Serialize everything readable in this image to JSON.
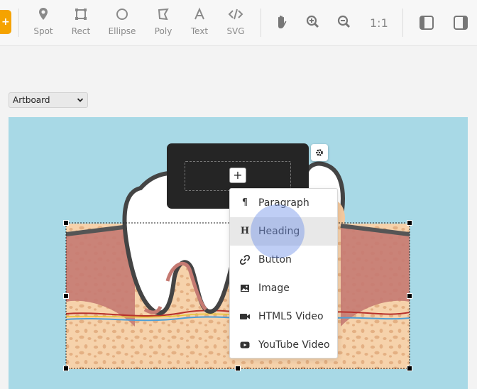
{
  "toolbar": {
    "tools": [
      {
        "name": "spot",
        "label": "Spot",
        "icon": "pin-icon"
      },
      {
        "name": "rect",
        "label": "Rect",
        "icon": "rect-icon"
      },
      {
        "name": "ellipse",
        "label": "Ellipse",
        "icon": "ellipse-icon"
      },
      {
        "name": "poly",
        "label": "Poly",
        "icon": "poly-icon"
      },
      {
        "name": "text",
        "label": "Text",
        "icon": "text-icon"
      },
      {
        "name": "svg",
        "label": "SVG",
        "icon": "code-icon"
      }
    ],
    "zoom_reset_label": "1:1",
    "accent": "#f5a300",
    "icons": [
      "hand-icon",
      "zoom-in-icon",
      "zoom-out-icon",
      "left-panel-icon",
      "right-panel-icon"
    ]
  },
  "artboard_select": {
    "value": "Artboard"
  },
  "canvas": {
    "background": "#a8d9e6"
  },
  "insert_menu": {
    "items": [
      {
        "label": "Paragraph",
        "icon": "paragraph-icon"
      },
      {
        "label": "Heading",
        "icon": "heading-icon",
        "active": true
      },
      {
        "label": "Button",
        "icon": "link-icon"
      },
      {
        "label": "Image",
        "icon": "image-icon"
      },
      {
        "label": "HTML5 Video",
        "icon": "video-icon"
      },
      {
        "label": "YouTube Video",
        "icon": "youtube-icon"
      }
    ]
  },
  "popup": {
    "add_label": "+"
  }
}
